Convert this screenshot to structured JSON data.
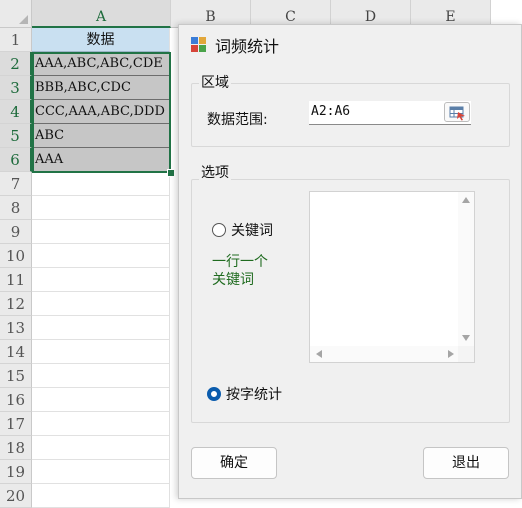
{
  "sheet": {
    "columns": [
      "A",
      "B",
      "C",
      "D",
      "E"
    ],
    "rows": [
      "1",
      "2",
      "3",
      "4",
      "5",
      "6",
      "7",
      "8",
      "9",
      "10",
      "11",
      "12",
      "13",
      "14",
      "15",
      "16",
      "17",
      "18",
      "19",
      "20"
    ],
    "header_cell": "数据",
    "cells": [
      "AAA,ABC,ABC,CDE",
      "BBB,ABC,CDC",
      "CCC,AAA,ABC,DDD",
      "ABC",
      "AAA"
    ]
  },
  "dialog": {
    "title": "词频统计",
    "region_group": "区域",
    "range_label": "数据范围:",
    "range_value": "A2:A6",
    "options_group": "选项",
    "keyword_option": "关键词",
    "keyword_hint_line1": "一行一个",
    "keyword_hint_line2": "关键词",
    "char_option": "按字统计",
    "selected_option": "按字统计",
    "ok_button": "确定",
    "exit_button": "退出"
  },
  "colors": {
    "accent": "#217346",
    "radio_selected": "#0b5cad",
    "hint": "#1f6b1f"
  }
}
